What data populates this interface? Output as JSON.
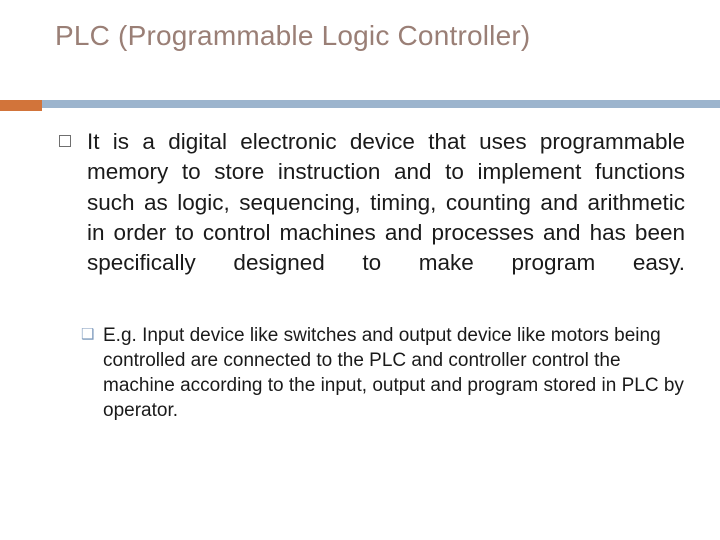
{
  "slide": {
    "title": "PLC (Programmable Logic Controller)",
    "accent_color": "#d2743a",
    "rule_color": "#9cb4cd",
    "title_color": "#9a7f76",
    "bullets": [
      {
        "level": 1,
        "marker": "square-outline",
        "text": "It is a digital electronic device that uses programmable memory to store instruction and to implement functions such as logic, sequencing, timing, counting and arithmetic in order to control machines and processes and has been specifically designed to make program easy."
      },
      {
        "level": 2,
        "marker": "❑",
        "text": "E.g.  Input device like switches and output device like motors being controlled are connected to the PLC and controller control the machine according to the input, output and program stored in PLC by operator."
      }
    ]
  }
}
